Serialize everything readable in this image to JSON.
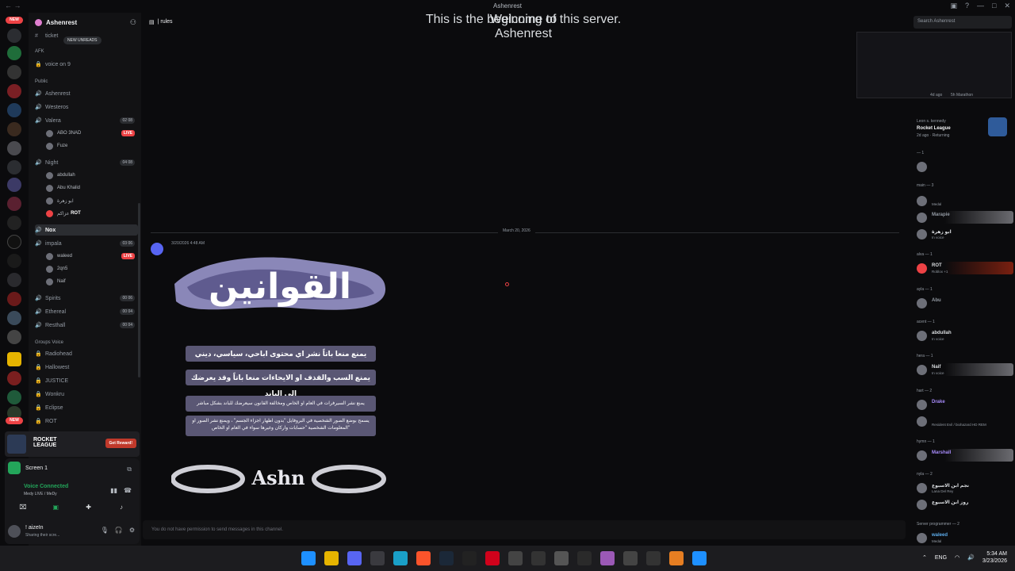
{
  "window": {
    "title": "Ashenrest"
  },
  "rail": {
    "new_badge": "NEW",
    "new_badge_bottom": "NEW"
  },
  "sidebar": {
    "server_name": "Ashenrest",
    "tooltip": "NEW UNREADS",
    "top_channel": "ticket",
    "cat_afk": "AFK",
    "afk_channel": "voice on 9",
    "cat_public": "Public",
    "channels": [
      {
        "name": "Ashenrest"
      },
      {
        "name": "Westeros"
      },
      {
        "name": "Valera",
        "count": "02",
        "limit": "08"
      },
      {
        "name": "Night",
        "count": "04",
        "limit": "08"
      },
      {
        "name": "Nox"
      },
      {
        "name": "impala",
        "count": "03",
        "limit": "06"
      },
      {
        "name": "Spirits",
        "count": "00",
        "limit": "06"
      },
      {
        "name": "Ethereal",
        "count": "00",
        "limit": "04"
      },
      {
        "name": "Resthall",
        "count": "00",
        "limit": "04"
      }
    ],
    "valera_users": [
      "ABO 3NAD",
      "Fuze"
    ],
    "night_users": [
      "abdullah",
      "Abu Khalid",
      "ابو زهرة",
      "عزاكم"
    ],
    "night_tag": "ROT",
    "impala_users": [
      "waleed",
      "2qn5",
      "Naif"
    ],
    "live_label": "LIVE",
    "cat_groups": "Groups Voice",
    "groups": [
      "Radiohead",
      "Hallowest",
      "JUSTICE",
      "Wonkru",
      "Eclipse",
      "ROT"
    ]
  },
  "promo": {
    "game": "ROCKET LEAGUE",
    "button": "Get Reward!"
  },
  "voice_panel": {
    "screen": "Screen 1",
    "status": "Voice Connected",
    "sub": "Medy LIVE / MeDy",
    "user_name": "! aizeIn",
    "user_status": "Sharing their scre..."
  },
  "main": {
    "channel": "| rules",
    "welcome_line1": "Welcome to",
    "welcome_line2": "Ashenrest",
    "welcome_sub": "This is the beginning of this server.",
    "date": "March 20, 2026",
    "msg_time": "3/20/2026 4:48 AM",
    "banner_title": "القوانين",
    "rules": [
      "يمنع منعا باتاً نشر اي محتوى اباحي، سياسي، ديني",
      "يمنع السب والقذف او الايحاءات منعا باتاً وقد يعرضك الى الباند",
      "يمنع نشر السيرفرات في العام او الخاص ومخالفة القانون سيعرضك للباند بشكل مباشر",
      "يسمح بوضع الصور الشخصية في البروفايل \"بدون اظهار اجزاء الجسم\" ، ويمنع نشر الصور او المعلومات الشخصية \"حسابات واركان وغيرها سواء في العام او الخاص\""
    ],
    "footer_logo": "Ashn",
    "compose_placeholder": "You do not have permission to send messages in this channel."
  },
  "members": {
    "search_placeholder": "Search Ashenrest",
    "activity1_time": "4d ago",
    "activity1_name": "5h Marathon",
    "activity2_user": "Leon s. kennedy",
    "activity2_game": "Rocket League",
    "activity2_time": "2d ago",
    "activity2_status": "Returning",
    "groups": [
      {
        "label": "— 1",
        "members": [
          {
            "name": "",
            "sub": ""
          }
        ]
      },
      {
        "label": "main — 3",
        "members": [
          {
            "name": "",
            "sub": "Medal"
          },
          {
            "name": "Marapie",
            "sub": ""
          },
          {
            "name": "ابو زهرة",
            "sub": "In voice"
          }
        ]
      },
      {
        "label": "alva — 1",
        "members": [
          {
            "name": "ROT",
            "sub": "Roblox +1"
          }
        ]
      },
      {
        "label": "ayla — 1",
        "members": [
          {
            "name": "Abu",
            "sub": ""
          }
        ]
      },
      {
        "label": "acent — 1",
        "members": [
          {
            "name": "abdullah",
            "sub": "In voice"
          }
        ]
      },
      {
        "label": "hera — 1",
        "members": [
          {
            "name": "Naif",
            "sub": "In voice"
          }
        ]
      },
      {
        "label": "hart — 2",
        "members": [
          {
            "name": "Drake",
            "sub": ""
          },
          {
            "name": "",
            "sub": "Resident Evil / biohazard HD REM"
          }
        ]
      },
      {
        "label": "hymn — 1",
        "members": [
          {
            "name": "Marshall",
            "sub": ""
          }
        ]
      },
      {
        "label": "nyla — 2",
        "members": [
          {
            "name": "نجم ابن الاسبوع",
            "sub": "Lana Del Rey"
          },
          {
            "name": "روز ابن الاسبوع",
            "sub": ""
          }
        ]
      },
      {
        "label": "Server programmer — 2",
        "members": [
          {
            "name": "waleed",
            "sub": "Medal"
          }
        ]
      }
    ]
  },
  "taskbar": {
    "lang": "ENG",
    "time": "5:34 AM",
    "date": "3/23/2026"
  },
  "colors": {
    "accent": "#5865f2",
    "live": "#ed4245",
    "online": "#23a55a",
    "bg": "#0b0b0d"
  }
}
